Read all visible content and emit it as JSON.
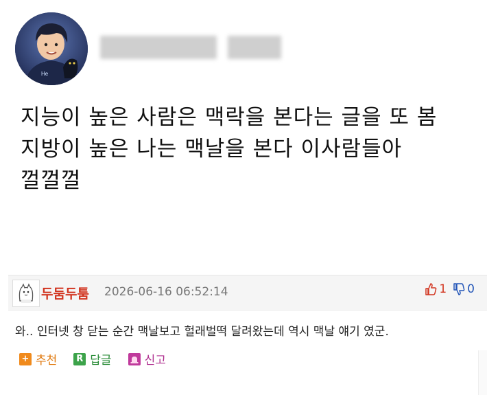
{
  "post": {
    "text": "지능이 높은 사람은 맥락을 본다는 글을 또 봄\n지방이 높은 나는 맥날을 본다 이사람들아\n껄껄껄"
  },
  "comment": {
    "author": "두둠두툼",
    "datetime": "2026-06-16 06:52:14",
    "up_count": "1",
    "down_count": "0",
    "body": "와.. 인터넷 창 닫는 순간 맥날보고 헐래벌떡 달려왔는데 역시 맥날 얘기 였군.",
    "actions": {
      "recommend": "추천",
      "reply": "답글",
      "report": "신고"
    }
  },
  "colors": {
    "author": "#d2341f",
    "up": "#d2341f",
    "down": "#2456b8",
    "recommend": "#f08a1c",
    "reply": "#3ca34a",
    "report": "#c03a9c"
  }
}
